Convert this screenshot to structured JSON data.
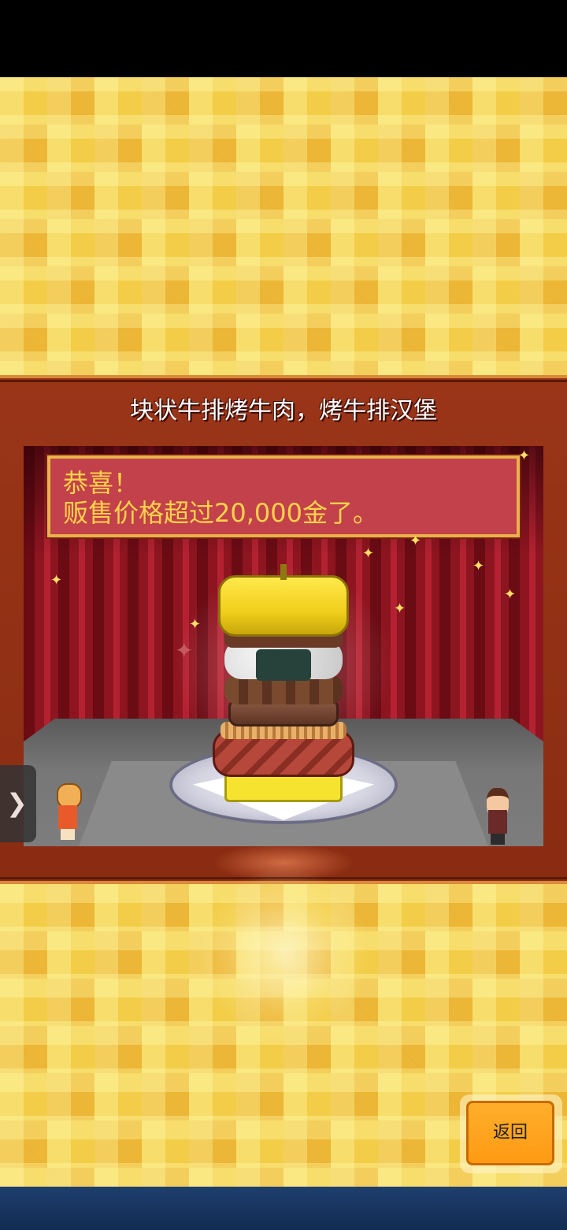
{
  "panel": {
    "title": "块状牛排烤牛肉，烤牛排汉堡"
  },
  "message": {
    "line1": "恭喜！",
    "line2": "贩售价格超过20,000金了。"
  },
  "side_tab": {
    "icon": "chevron-right-icon",
    "glyph": "❯"
  },
  "buttons": {
    "back_label": "返回"
  },
  "colors": {
    "message_text": "#ffd24a",
    "message_bg": "#c2414a",
    "back_button": "#ff9a12",
    "panel_bg": "#8a2c12",
    "checker_gold": "#f3cd48"
  }
}
